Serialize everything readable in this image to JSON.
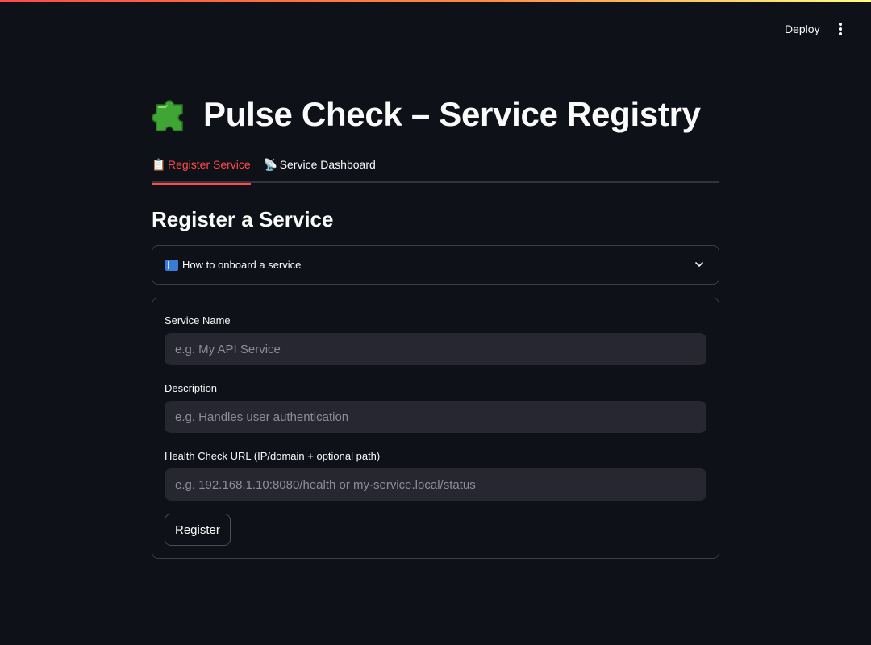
{
  "header": {
    "deploy_label": "Deploy",
    "menu_icon": "vertical-ellipsis-icon"
  },
  "page": {
    "title_icon": "puzzle-piece-icon",
    "title": "Pulse Check – Service Registry"
  },
  "tabs": [
    {
      "icon": "📋",
      "label": "Register Service",
      "active": true
    },
    {
      "icon": "📡",
      "label": "Service Dashboard",
      "active": false
    }
  ],
  "section": {
    "heading": "Register a Service"
  },
  "expander": {
    "icon": "blue-book-icon",
    "label": "How to onboard a service",
    "expanded": false
  },
  "form": {
    "fields": [
      {
        "label": "Service Name",
        "value": "",
        "placeholder": "e.g. My API Service"
      },
      {
        "label": "Description",
        "value": "",
        "placeholder": "e.g. Handles user authentication"
      },
      {
        "label": "Health Check URL (IP/domain + optional path)",
        "value": "",
        "placeholder": "e.g. 192.168.1.10:8080/health or my-service.local/status"
      }
    ],
    "submit_label": "Register"
  },
  "colors": {
    "background": "#0e1117",
    "accent": "#ff4b4b",
    "input_background": "#262730",
    "border": "#3b3d47"
  }
}
